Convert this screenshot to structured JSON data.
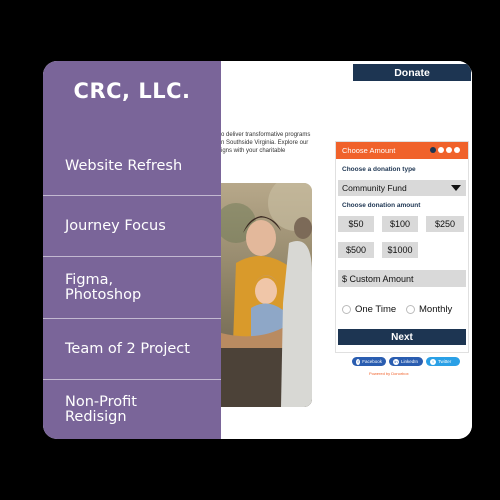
{
  "sidebar": {
    "brand": "CRC, LLC.",
    "items": [
      {
        "label": "Website Refresh"
      },
      {
        "label": "Journey Focus"
      },
      {
        "label": "Figma,\nPhotoshop"
      },
      {
        "label": "Team of 2 Project"
      },
      {
        "label": "Non-Profit\nRedisign"
      }
    ]
  },
  "mock": {
    "donate_label": "Donate",
    "intro_lines": [
      "o deliver transformative programs",
      "n Southside Virginia. Explore our",
      "igns with your charitable"
    ],
    "form": {
      "header": "Choose Amount",
      "type_label": "Choose a donation type",
      "type_value": "Community Fund",
      "amount_label": "Choose donation amount",
      "amounts": [
        "$50",
        "$100",
        "$250",
        "$500",
        "$1000"
      ],
      "custom": "$ Custom Amount",
      "one_time": "One Time",
      "monthly": "Monthly",
      "next": "Next"
    },
    "social": [
      "Facebook",
      "LinkedIn",
      "Twitter"
    ],
    "powered": "Powered by Donorbox"
  },
  "colors": {
    "sidebar": "#7a6599",
    "navy": "#1d3552",
    "orange": "#f0622b",
    "gray": "#d9d9d9"
  }
}
